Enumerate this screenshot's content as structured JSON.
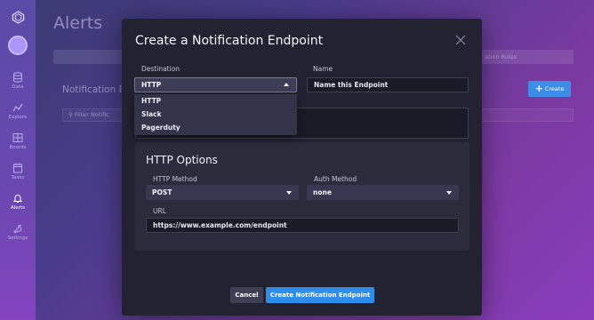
{
  "nav": {
    "items": [
      {
        "label": "Data",
        "icon": "data-icon"
      },
      {
        "label": "Explore",
        "icon": "explore-icon"
      },
      {
        "label": "Boards",
        "icon": "boards-icon"
      },
      {
        "label": "Tasks",
        "icon": "tasks-icon"
      },
      {
        "label": "Alerts",
        "icon": "bell-icon"
      },
      {
        "label": "Settings",
        "icon": "wrench-icon"
      }
    ]
  },
  "page": {
    "title": "Alerts",
    "subtitle": "Notification En",
    "tab_right": "ation Rules",
    "filter_placeholder": "Filter Notific",
    "create_label": "Create"
  },
  "modal": {
    "title": "Create a Notification Endpoint",
    "destination_label": "Destination",
    "destination_value": "HTTP",
    "destination_options": [
      "HTTP",
      "Slack",
      "Pagerduty"
    ],
    "name_label": "Name",
    "name_value": "Name this Endpoint",
    "http_options": {
      "title": "HTTP Options",
      "method_label": "HTTP Method",
      "method_value": "POST",
      "auth_label": "Auth Method",
      "auth_value": "none",
      "url_label": "URL",
      "url_value": "https://www.example.com/endpoint"
    },
    "cancel_label": "Cancel",
    "submit_label": "Create Notification Endpoint"
  },
  "colors": {
    "accent": "#2d8de8",
    "modal_bg": "#222231",
    "panel_bg": "#2b2b3c"
  }
}
